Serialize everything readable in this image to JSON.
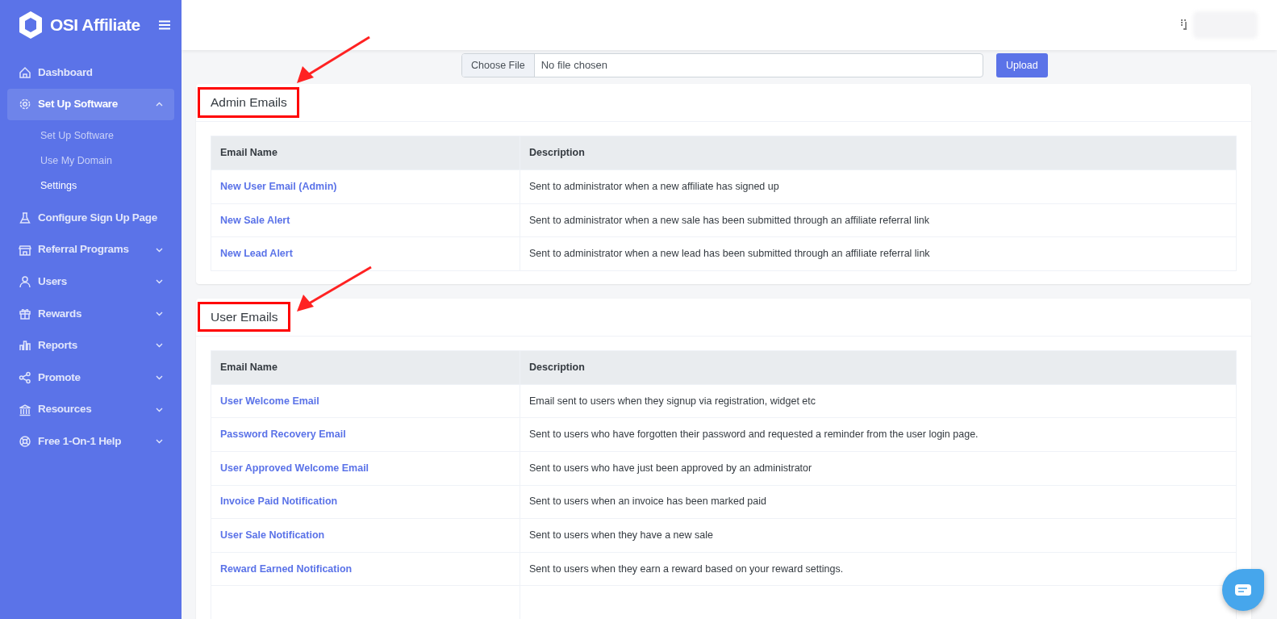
{
  "brand": {
    "name": "OSI Affiliate"
  },
  "sidebar": {
    "items": [
      {
        "label": "Dashboard",
        "selected": false
      },
      {
        "label": "Set Up Software",
        "selected": true,
        "expanded": true,
        "children": [
          {
            "label": "Set Up Software",
            "selected": false
          },
          {
            "label": "Use My Domain",
            "selected": false
          },
          {
            "label": "Settings",
            "selected": true
          }
        ]
      },
      {
        "label": "Configure Sign Up Page",
        "selected": false
      },
      {
        "label": "Referral Programs",
        "selected": false,
        "expanded": false
      },
      {
        "label": "Users",
        "selected": false,
        "expanded": false
      },
      {
        "label": "Rewards",
        "selected": false,
        "expanded": false
      },
      {
        "label": "Reports",
        "selected": false,
        "expanded": false
      },
      {
        "label": "Promote",
        "selected": false,
        "expanded": false
      },
      {
        "label": "Resources",
        "selected": false,
        "expanded": false
      },
      {
        "label": "Free 1-On-1 Help",
        "selected": false,
        "expanded": false
      }
    ]
  },
  "file_upload": {
    "choose_button": "Choose File",
    "file_name": "No file chosen",
    "upload_button": "Upload"
  },
  "sections": [
    {
      "title": "Admin Emails",
      "highlighted": true,
      "columns": [
        "Email Name",
        "Description"
      ],
      "rows": [
        {
          "name": "New User Email (Admin)",
          "description": "Sent to administrator when a new affiliate has signed up"
        },
        {
          "name": "New Sale Alert",
          "description": "Sent to administrator when a new sale has been submitted through an affiliate referral link"
        },
        {
          "name": "New Lead Alert",
          "description": "Sent to administrator when a new lead has been submitted through an affiliate referral link"
        }
      ]
    },
    {
      "title": "User Emails",
      "highlighted": true,
      "columns": [
        "Email Name",
        "Description"
      ],
      "rows": [
        {
          "name": "User Welcome Email",
          "description": "Email sent to users when they signup via registration, widget etc"
        },
        {
          "name": "Password Recovery Email",
          "description": "Sent to users who have forgotten their password and requested a reminder from the user login page."
        },
        {
          "name": "User Approved Welcome Email",
          "description": "Sent to users who have just been approved by an administrator"
        },
        {
          "name": "Invoice Paid Notification",
          "description": "Sent to users when an invoice has been marked paid"
        },
        {
          "name": "User Sale Notification",
          "description": "Sent to users when they have a new sale"
        },
        {
          "name": "Reward Earned Notification",
          "description": "Sent to users when they earn a reward based on your reward settings."
        }
      ]
    }
  ]
}
